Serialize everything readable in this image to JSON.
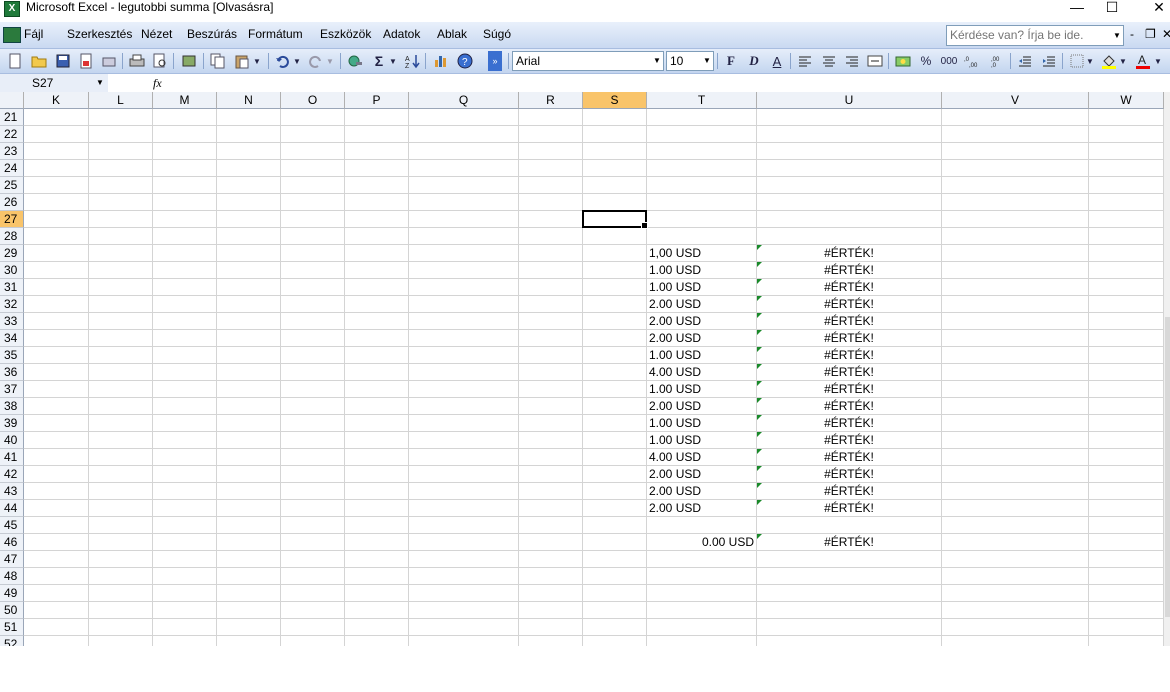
{
  "window": {
    "title": "Microsoft Excel - legutobbi summa  [Olvasásra]",
    "app_icon_letter": "X",
    "minimize": "—",
    "maximize": "☐",
    "close": "✕"
  },
  "menu": {
    "items": [
      "Fájl",
      "Szerkesztés",
      "Nézet",
      "Beszúrás",
      "Formátum",
      "Eszközök",
      "Adatok",
      "Ablak",
      "Súgó"
    ],
    "help_placeholder": "Kérdése van? Írja be ide.",
    "mdi_minimize": "-",
    "mdi_restore": "❐",
    "mdi_close": "✕"
  },
  "toolbar": {
    "font_name": "Arial",
    "font_size": "10",
    "bold_label": "F",
    "italic_label": "D",
    "underline_label": "A",
    "percent_label": "%",
    "thousands_label": "000",
    "sigma_label": "Σ"
  },
  "formula_bar": {
    "name_box": "S27",
    "fx_label": "fx",
    "content": ""
  },
  "sheet": {
    "columns": [
      "K",
      "L",
      "M",
      "N",
      "O",
      "P",
      "Q",
      "R",
      "S",
      "T",
      "U",
      "V",
      "W"
    ],
    "selected_column": "S",
    "rows": [
      "21",
      "22",
      "23",
      "24",
      "25",
      "26",
      "27",
      "28",
      "29",
      "30",
      "31",
      "32",
      "33",
      "34",
      "35",
      "36",
      "37",
      "38",
      "39",
      "40",
      "41",
      "42",
      "43",
      "44",
      "45",
      "46",
      "47",
      "48",
      "49",
      "50",
      "51",
      "52"
    ],
    "selected_row": "27",
    "active_cell": "S27",
    "t_values": {
      "29": "1,00 USD",
      "30": "1.00 USD",
      "31": "1.00 USD",
      "32": "2.00 USD",
      "33": "2.00 USD",
      "34": "2.00 USD",
      "35": "1.00 USD",
      "36": "4.00 USD",
      "37": "1.00 USD",
      "38": "2.00 USD",
      "39": "1.00 USD",
      "40": "1.00 USD",
      "41": "4.00 USD",
      "42": "2.00 USD",
      "43": "2.00 USD",
      "44": "2.00 USD",
      "46": "0.00 USD"
    },
    "u_values": {
      "29": "#ÉRTÉK!",
      "30": "#ÉRTÉK!",
      "31": "#ÉRTÉK!",
      "32": "#ÉRTÉK!",
      "33": "#ÉRTÉK!",
      "34": "#ÉRTÉK!",
      "35": "#ÉRTÉK!",
      "36": "#ÉRTÉK!",
      "37": "#ÉRTÉK!",
      "38": "#ÉRTÉK!",
      "39": "#ÉRTÉK!",
      "40": "#ÉRTÉK!",
      "41": "#ÉRTÉK!",
      "42": "#ÉRTÉK!",
      "43": "#ÉRTÉK!",
      "44": "#ÉRTÉK!",
      "46": "#ÉRTÉK!"
    },
    "right_aligned_t_rows": [
      "46"
    ],
    "error_indicator_rows": [
      "29",
      "30",
      "31",
      "32",
      "33",
      "34",
      "35",
      "36",
      "37",
      "38",
      "39",
      "40",
      "41",
      "42",
      "43",
      "44",
      "46"
    ]
  }
}
